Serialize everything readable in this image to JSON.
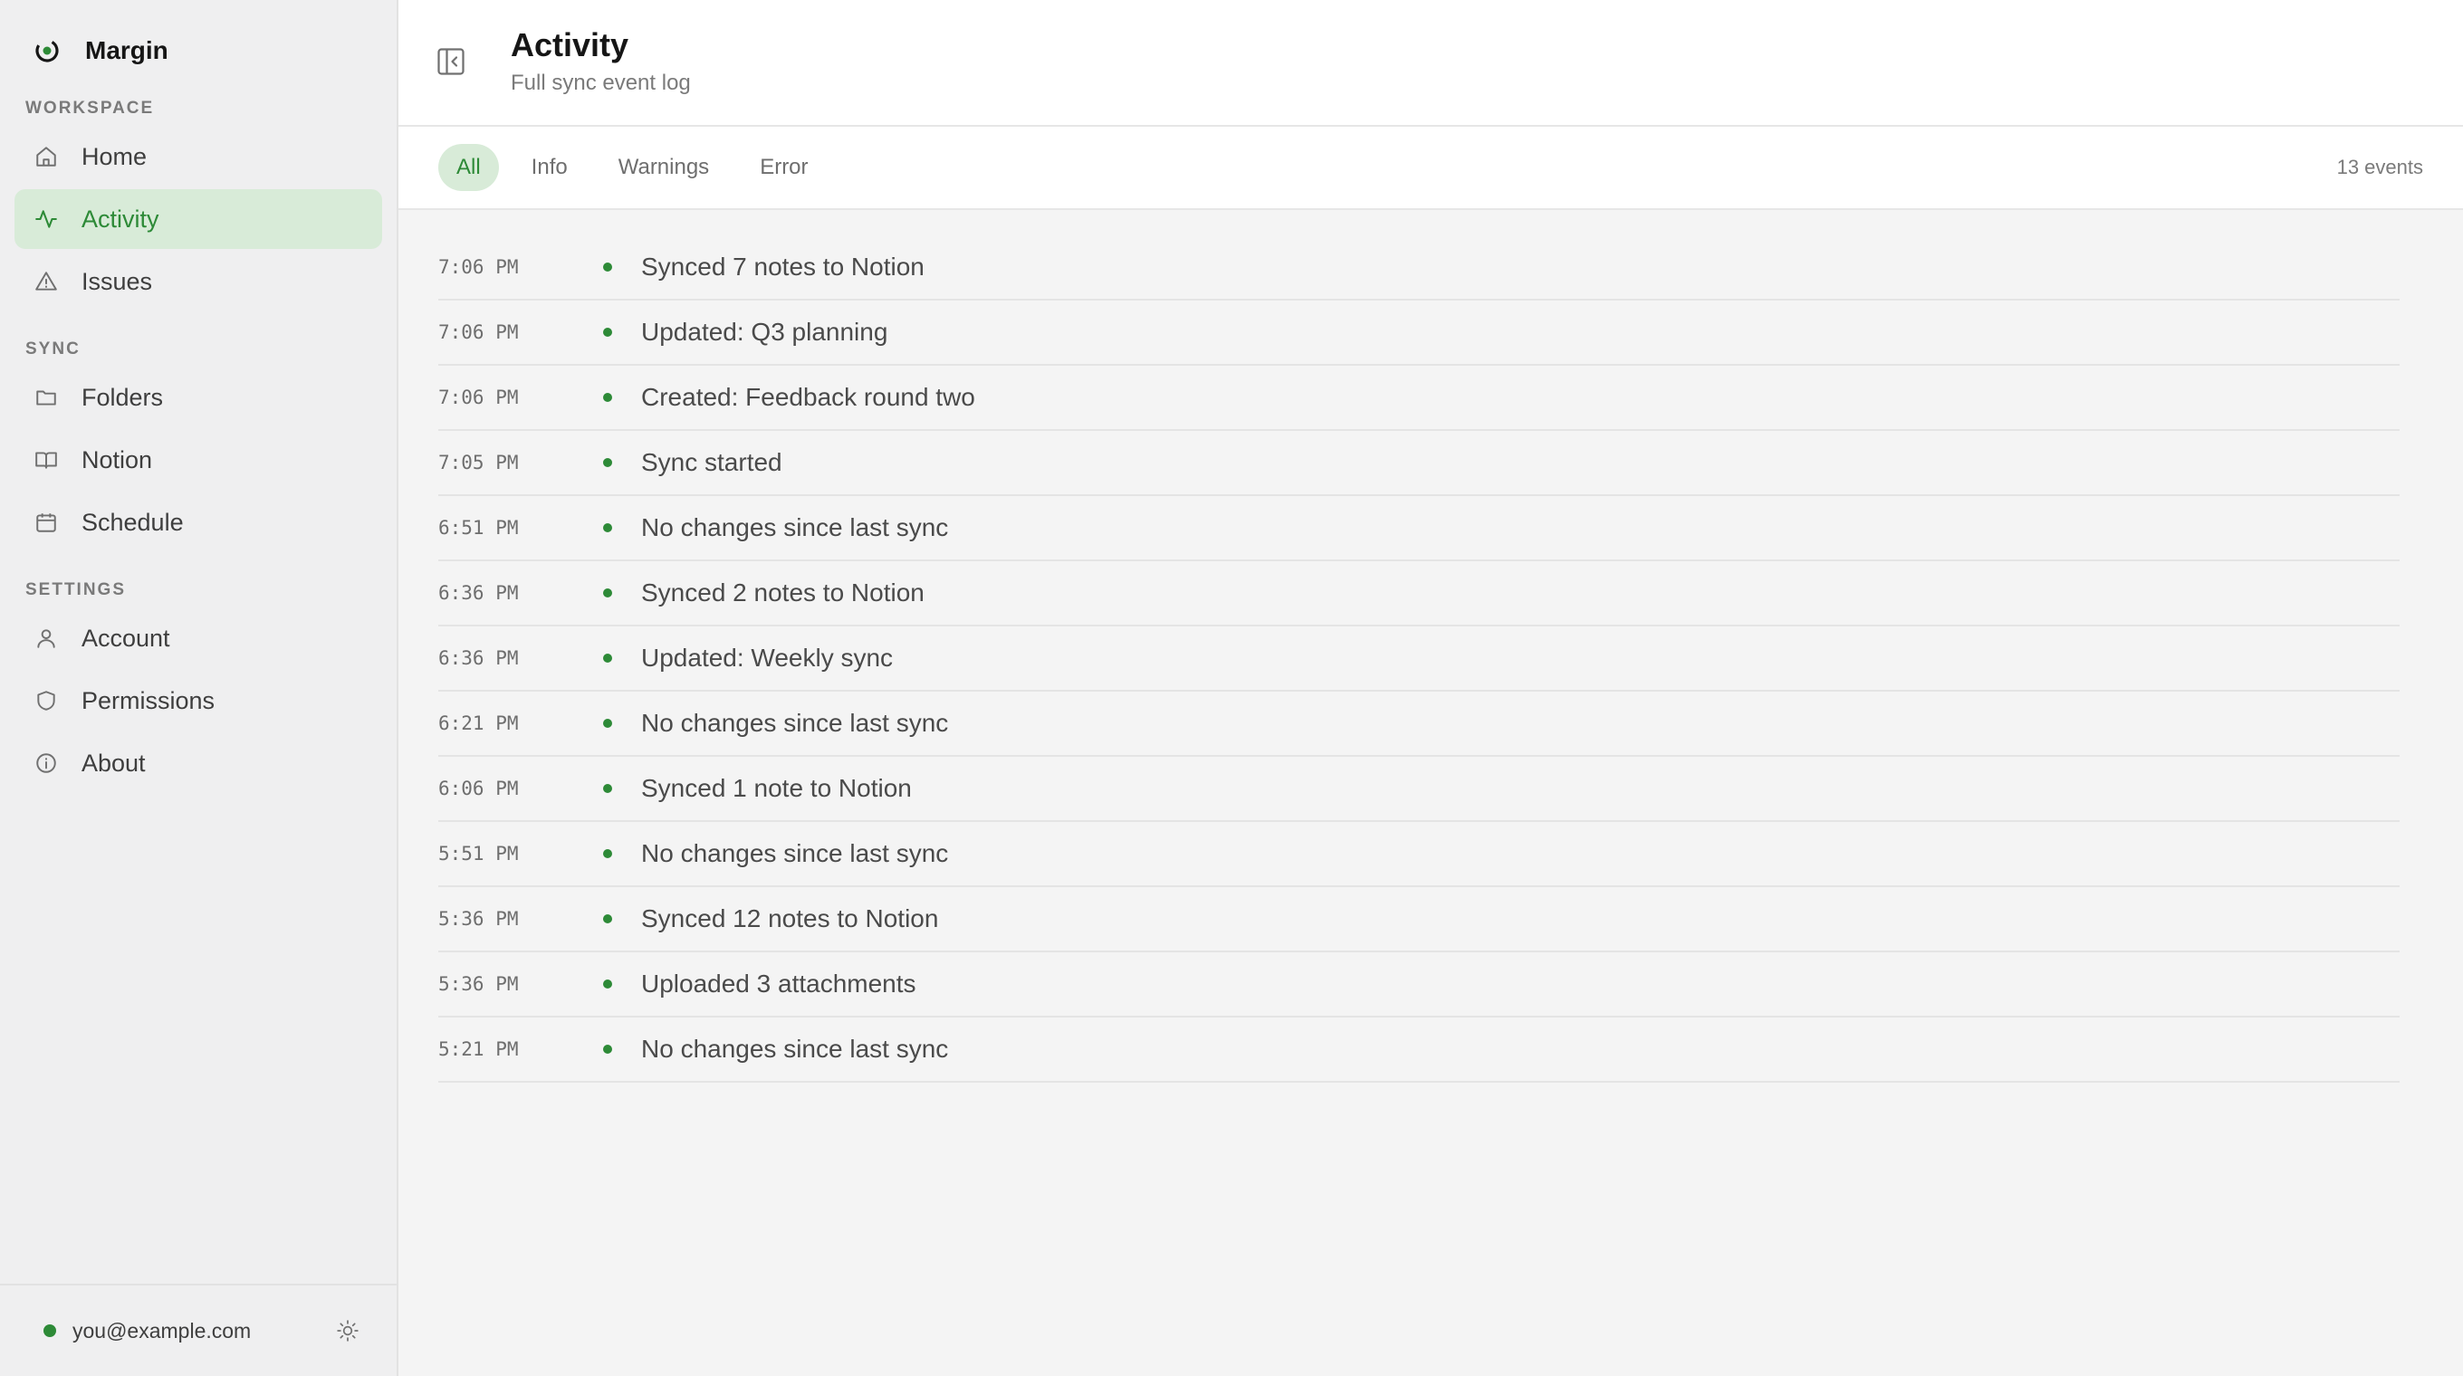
{
  "app": {
    "name": "Margin",
    "accent": "#2d8a37"
  },
  "sidebar": {
    "sections": [
      {
        "label": "WORKSPACE",
        "items": [
          {
            "label": "Home",
            "icon": "home-icon"
          },
          {
            "label": "Activity",
            "icon": "activity-icon",
            "active": true
          },
          {
            "label": "Issues",
            "icon": "warning-icon"
          }
        ]
      },
      {
        "label": "SYNC",
        "items": [
          {
            "label": "Folders",
            "icon": "folder-icon"
          },
          {
            "label": "Notion",
            "icon": "book-icon"
          },
          {
            "label": "Schedule",
            "icon": "calendar-icon"
          }
        ]
      },
      {
        "label": "SETTINGS",
        "items": [
          {
            "label": "Account",
            "icon": "user-icon"
          },
          {
            "label": "Permissions",
            "icon": "shield-icon"
          },
          {
            "label": "About",
            "icon": "info-icon"
          }
        ]
      }
    ],
    "footer": {
      "email": "you@example.com",
      "status": "connected",
      "theme_icon": "sun-icon"
    }
  },
  "header": {
    "title": "Activity",
    "subtitle": "Full sync event log"
  },
  "filters": {
    "tabs": [
      "All",
      "Info",
      "Warnings",
      "Error"
    ],
    "selected": "All",
    "count": "13 events"
  },
  "events": [
    {
      "time": "7:06 PM",
      "message": "Synced 7 notes to Notion"
    },
    {
      "time": "7:06 PM",
      "message": "Updated: Q3 planning"
    },
    {
      "time": "7:06 PM",
      "message": "Created: Feedback round two"
    },
    {
      "time": "7:05 PM",
      "message": "Sync started"
    },
    {
      "time": "6:51 PM",
      "message": "No changes since last sync"
    },
    {
      "time": "6:36 PM",
      "message": "Synced 2 notes to Notion"
    },
    {
      "time": "6:36 PM",
      "message": "Updated: Weekly sync"
    },
    {
      "time": "6:21 PM",
      "message": "No changes since last sync"
    },
    {
      "time": "6:06 PM",
      "message": "Synced 1 note to Notion"
    },
    {
      "time": "5:51 PM",
      "message": "No changes since last sync"
    },
    {
      "time": "5:36 PM",
      "message": "Synced 12 notes to Notion"
    },
    {
      "time": "5:36 PM",
      "message": "Uploaded 3 attachments"
    },
    {
      "time": "5:21 PM",
      "message": "No changes since last sync"
    }
  ]
}
